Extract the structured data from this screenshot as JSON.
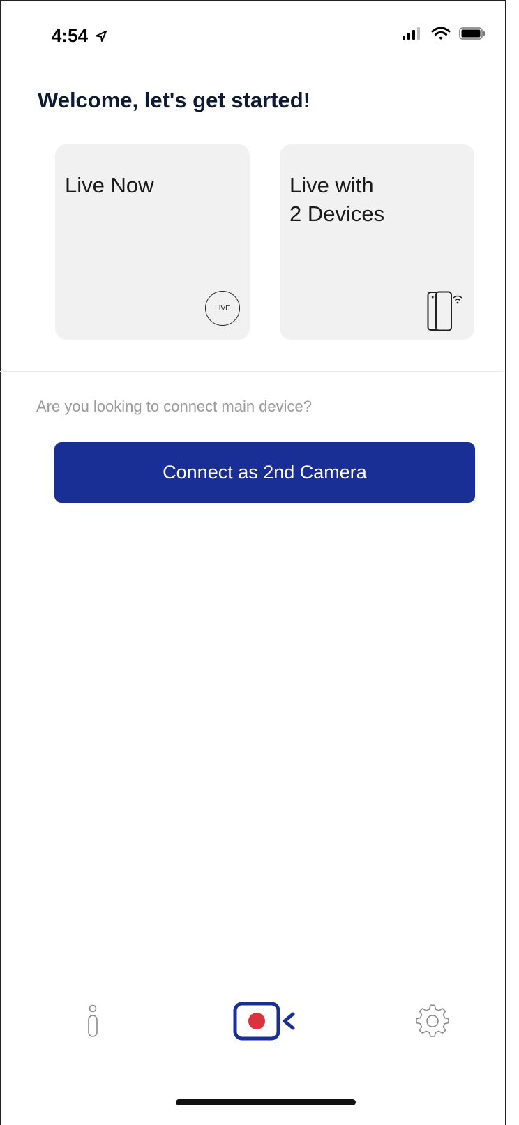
{
  "status_bar": {
    "time": "4:54"
  },
  "header": {
    "title": "Welcome, let's get started!"
  },
  "cards": {
    "live_now": {
      "label": "Live Now",
      "badge": "LIVE"
    },
    "live_two_devices": {
      "label": "Live with\n2 Devices"
    }
  },
  "connect": {
    "prompt": "Are you looking to connect main device?",
    "button_label": "Connect as 2nd Camera"
  },
  "tab_bar": {
    "icons": [
      "info-icon",
      "record-camera-icon",
      "gear-icon"
    ]
  },
  "colors": {
    "primary": "#1a2f96",
    "record_red": "#d9343e",
    "card_bg": "#f1f1f1",
    "muted_text": "#9a9a9a"
  }
}
